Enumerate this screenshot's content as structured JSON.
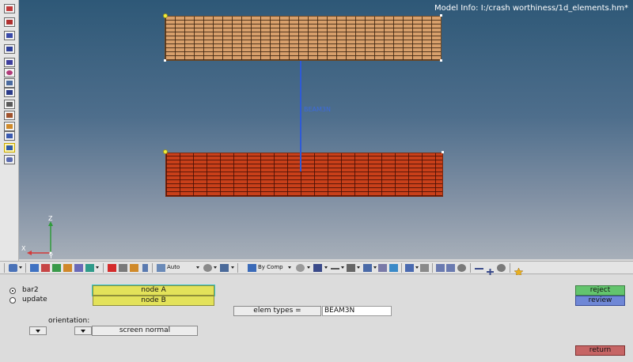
{
  "model_info": "Model Info: I:/crash worthiness/1d_elements.hm*",
  "beam_label": "BEAM3N",
  "triad": {
    "x": "X",
    "y": "Y",
    "z": "Z"
  },
  "toolbar": {
    "auto_label": "Auto",
    "color_mode_label": "By Comp"
  },
  "panel": {
    "radio_options": [
      {
        "label": "bar2",
        "selected": true
      },
      {
        "label": "update",
        "selected": false
      }
    ],
    "node_a": "node A",
    "node_b": "node B",
    "elem_types_label": "elem types =",
    "elem_types_value": "BEAM3N",
    "orientation_label": "orientation:",
    "orientation_value": "screen normal",
    "reject": "reject",
    "review": "review",
    "return": "return"
  },
  "colors": {
    "top_mesh": "#d8a06c",
    "bottom_mesh": "#c9401a",
    "beam": "#2f5ad6",
    "reject": "#63c46d",
    "review": "#6f87d6",
    "return": "#c66565",
    "selector": "#e3e25a"
  }
}
